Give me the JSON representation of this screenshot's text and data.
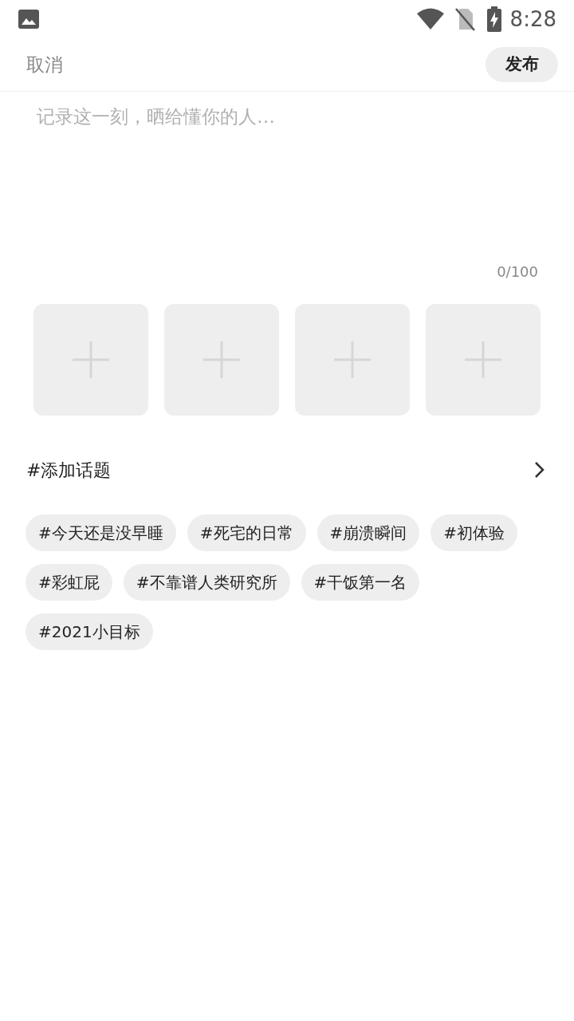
{
  "status_bar": {
    "time": "8:28"
  },
  "header": {
    "cancel": "取消",
    "publish": "发布"
  },
  "editor": {
    "placeholder": "记录这一刻，晒给懂你的人…",
    "counter": "0/100"
  },
  "photo_slots": [
    {
      "kind": "add"
    },
    {
      "kind": "add"
    },
    {
      "kind": "add"
    },
    {
      "kind": "add"
    }
  ],
  "topic_row": {
    "label": "#添加话题"
  },
  "tags": [
    "#今天还是没早睡",
    "#死宅的日常",
    "#崩溃瞬间",
    "#初体验",
    "#彩虹屁",
    "#不靠谱人类研究所",
    "#干饭第一名",
    "#2021小目标"
  ]
}
